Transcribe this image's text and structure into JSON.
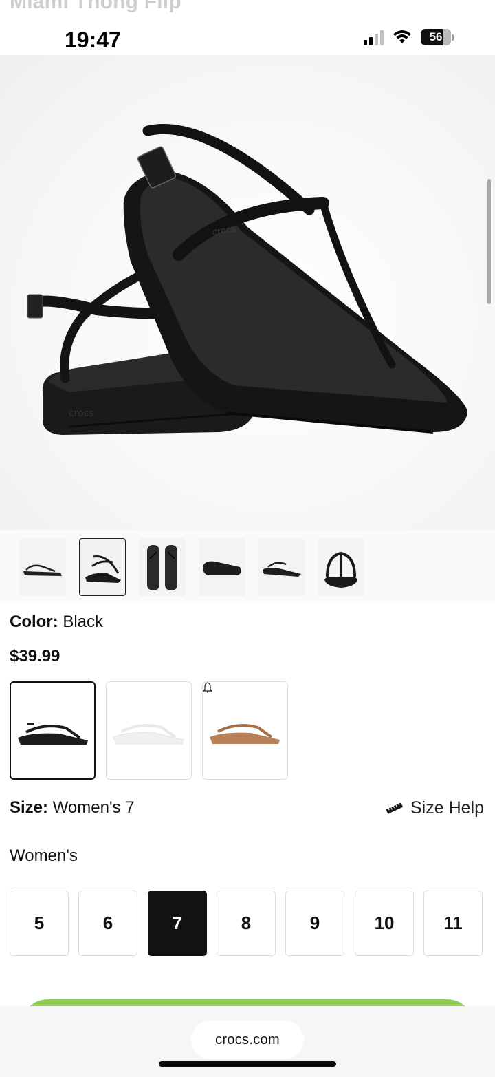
{
  "page": {
    "ghost_title": "Miami Thong Flip"
  },
  "status_bar": {
    "time": "19:47",
    "battery": "56",
    "signal_icon": "cellular-signal-icon",
    "wifi_icon": "wifi-icon",
    "battery_icon": "battery-icon"
  },
  "gallery": {
    "thumbnails": [
      "thumb-side",
      "thumb-pair",
      "thumb-top",
      "thumb-sole",
      "thumb-side-2",
      "thumb-front"
    ],
    "selected_index": 1
  },
  "product": {
    "color_label": "Color:",
    "color_value": "Black",
    "price": "$39.99",
    "swatches": [
      {
        "name": "Black",
        "color": "#1c1c1c",
        "selected": true
      },
      {
        "name": "White",
        "color": "#f2f2f2",
        "selected": false
      },
      {
        "name": "Tan",
        "color": "#b8815a",
        "selected": false,
        "notify_icon": "bell-icon"
      }
    ],
    "size_label": "Size:",
    "size_value": "Women's 7",
    "size_help": "Size Help",
    "size_help_icon": "ruler-icon",
    "size_group": "Women's",
    "sizes": [
      "5",
      "6",
      "7",
      "8",
      "9",
      "10",
      "11"
    ],
    "selected_size": "7"
  },
  "browser": {
    "url": "crocs.com"
  },
  "colors": {
    "cta_green": "#8fcc55",
    "selected_dark": "#121212"
  }
}
